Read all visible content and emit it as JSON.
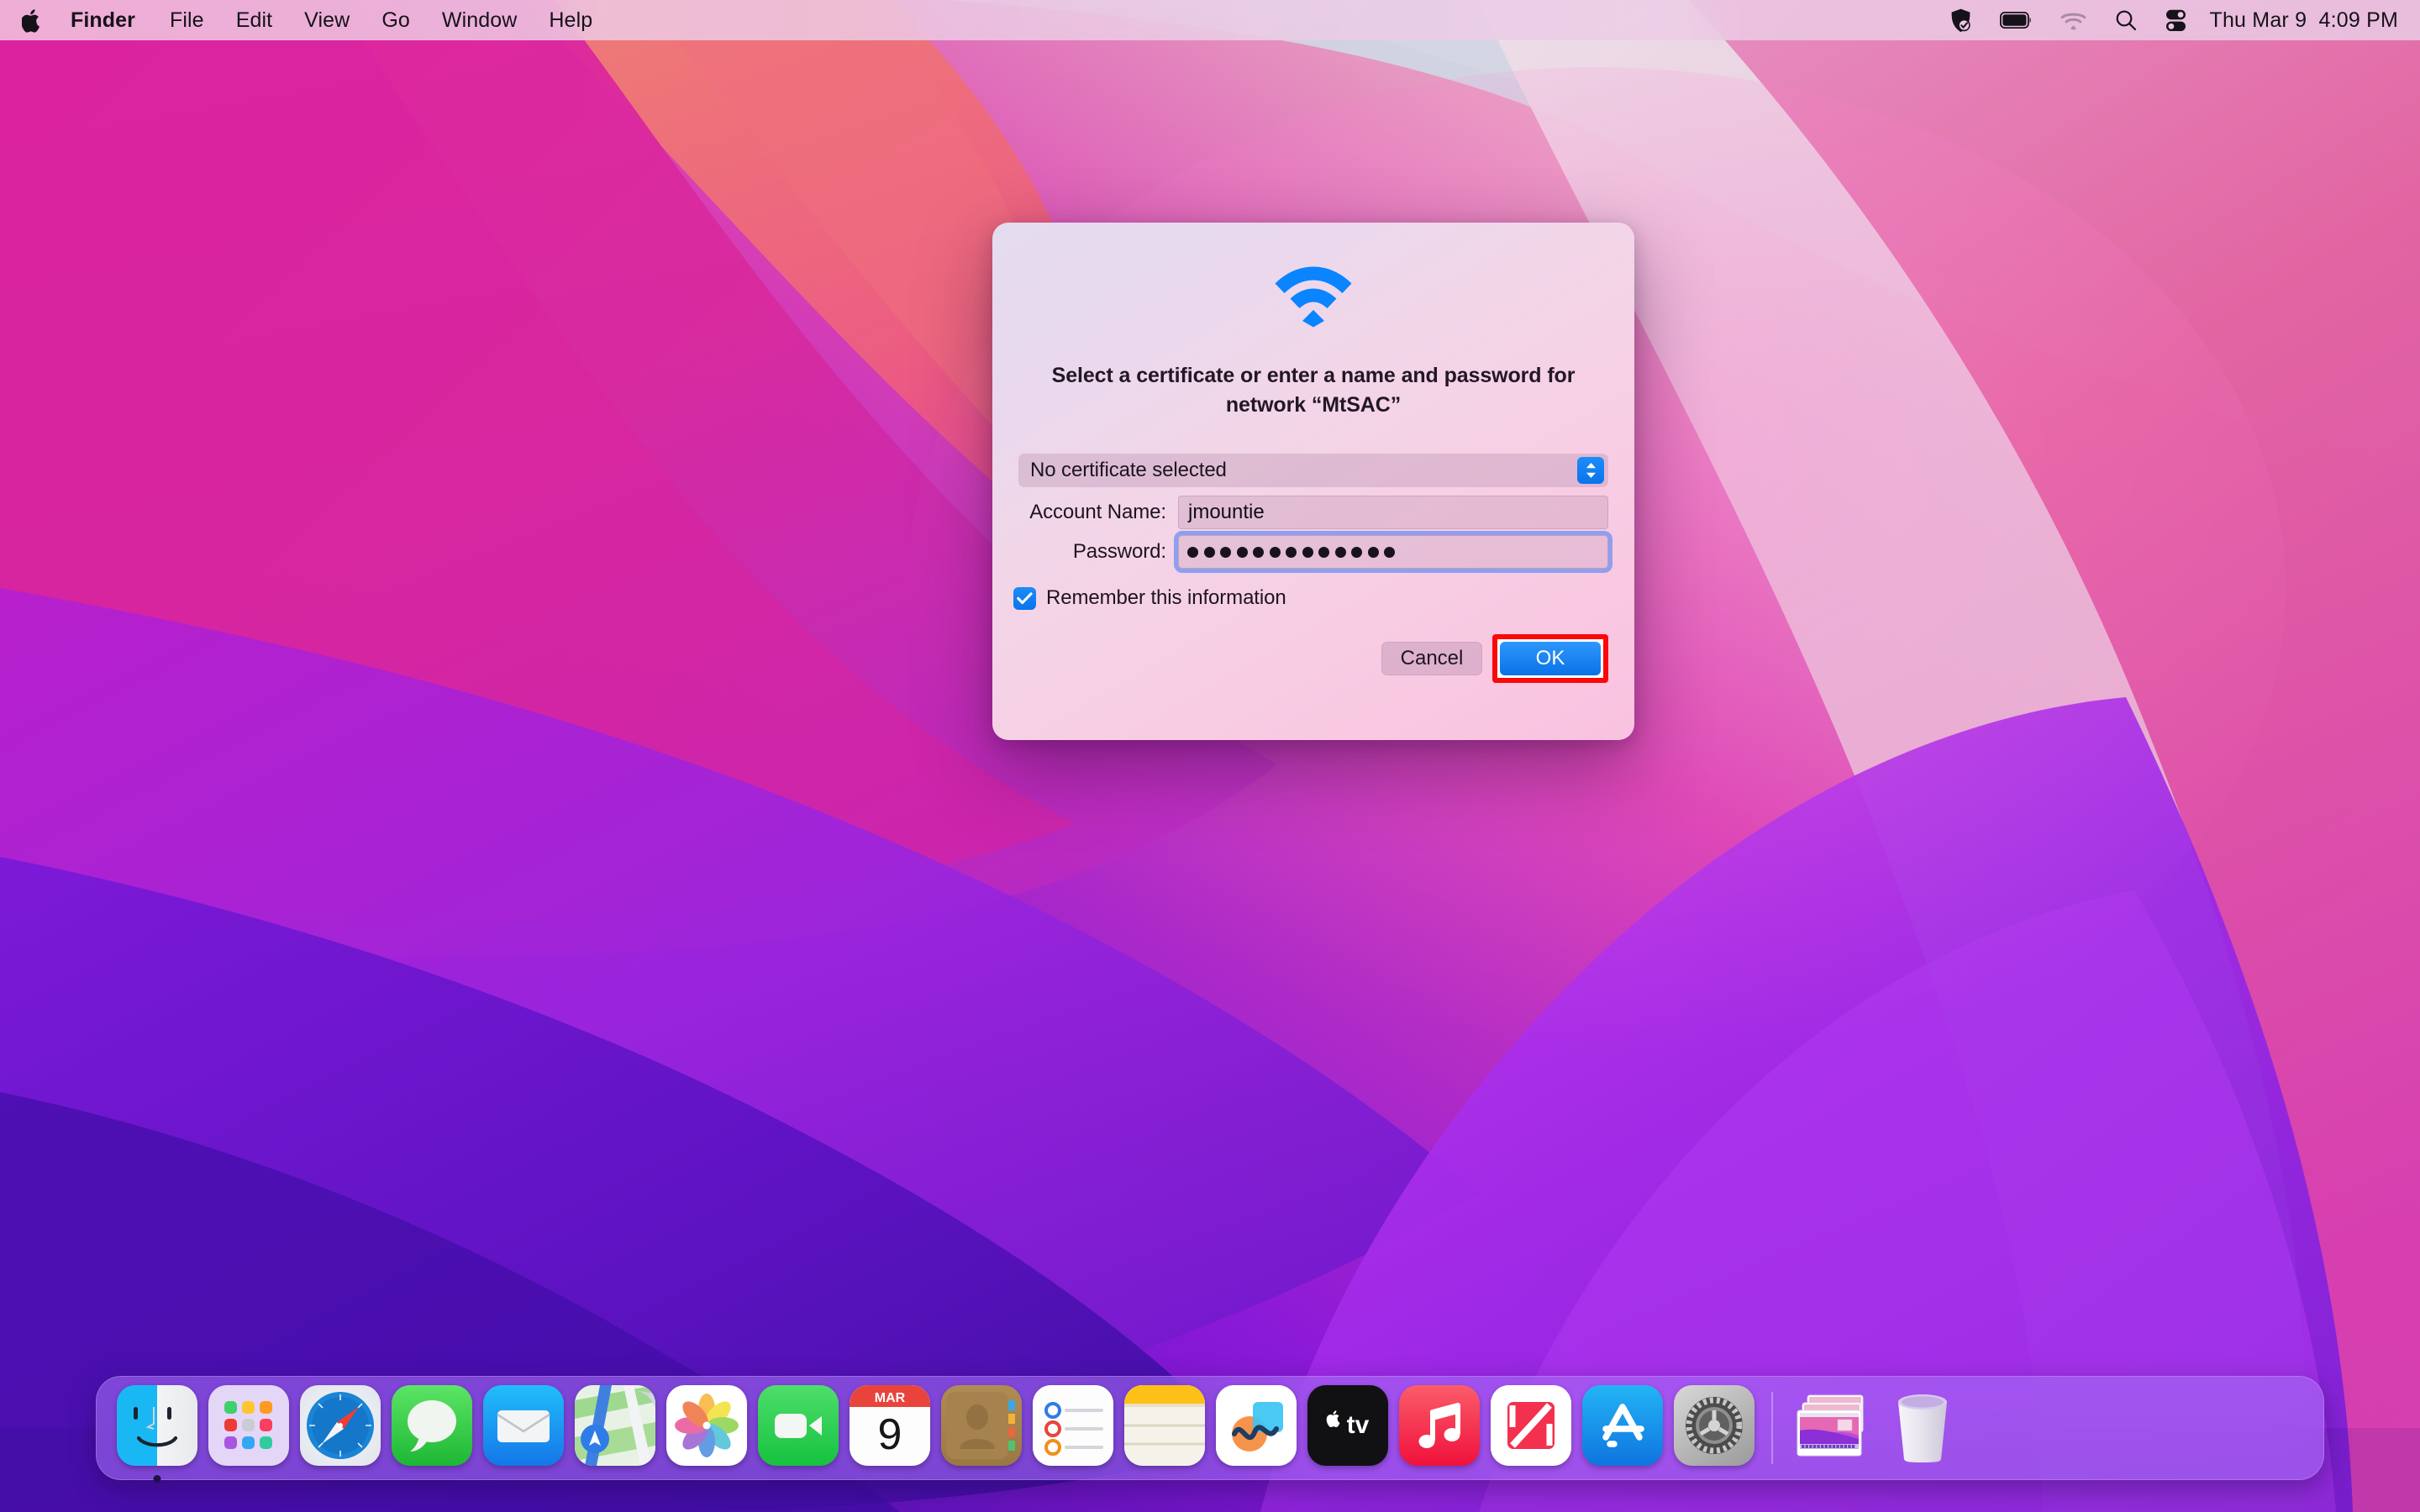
{
  "menubar": {
    "apple_icon": "apple-logo-icon",
    "items": [
      {
        "label": "Finder",
        "bold": true
      },
      {
        "label": "File",
        "bold": false
      },
      {
        "label": "Edit",
        "bold": false
      },
      {
        "label": "View",
        "bold": false
      },
      {
        "label": "Go",
        "bold": false
      },
      {
        "label": "Window",
        "bold": false
      },
      {
        "label": "Help",
        "bold": false
      }
    ],
    "status_icons": [
      "shield-check-icon",
      "battery-icon",
      "wifi-icon",
      "search-icon",
      "control-center-icon"
    ],
    "clock": "Thu Mar 9  4:09 PM"
  },
  "dialog": {
    "icon": "wifi-icon",
    "title": "Select a certificate or enter a name and password for network “MtSAC”",
    "certificate": {
      "label": "No certificate selected",
      "stepper_icon": "chevron-up-down-icon"
    },
    "account": {
      "label": "Account Name:",
      "value": "jmountie"
    },
    "password": {
      "label": "Password:",
      "value": "•••••••••••••",
      "dot_count": 13,
      "focused": true
    },
    "remember": {
      "label": "Remember this information",
      "checked": true
    },
    "cancel_label": "Cancel",
    "ok_label": "OK",
    "ok_highlight_color": "#fc0808",
    "accent_color": "#0a74ec"
  },
  "dock": {
    "items": [
      {
        "name": "finder",
        "label": "Finder",
        "running": true
      },
      {
        "name": "launchpad",
        "label": "Launchpad",
        "running": false
      },
      {
        "name": "safari",
        "label": "Safari",
        "running": false
      },
      {
        "name": "messages",
        "label": "Messages",
        "running": false
      },
      {
        "name": "mail",
        "label": "Mail",
        "running": false
      },
      {
        "name": "maps",
        "label": "Maps",
        "running": false
      },
      {
        "name": "photos",
        "label": "Photos",
        "running": false
      },
      {
        "name": "facetime",
        "label": "FaceTime",
        "running": false
      },
      {
        "name": "calendar",
        "label": "Calendar",
        "running": false,
        "month": "MAR",
        "day": "9"
      },
      {
        "name": "contacts",
        "label": "Contacts",
        "running": false
      },
      {
        "name": "reminders",
        "label": "Reminders",
        "running": false
      },
      {
        "name": "notes",
        "label": "Notes",
        "running": false
      },
      {
        "name": "freeform",
        "label": "Freeform",
        "running": false
      },
      {
        "name": "tv",
        "label": "TV",
        "running": false
      },
      {
        "name": "music",
        "label": "Music",
        "running": false
      },
      {
        "name": "news",
        "label": "News",
        "running": false
      },
      {
        "name": "appstore",
        "label": "App Store",
        "running": false
      },
      {
        "name": "sysprefs",
        "label": "System Preferences",
        "running": false
      }
    ],
    "right_items": [
      {
        "name": "screenshots-stack",
        "label": "Screenshots"
      },
      {
        "name": "trash",
        "label": "Trash"
      }
    ]
  }
}
